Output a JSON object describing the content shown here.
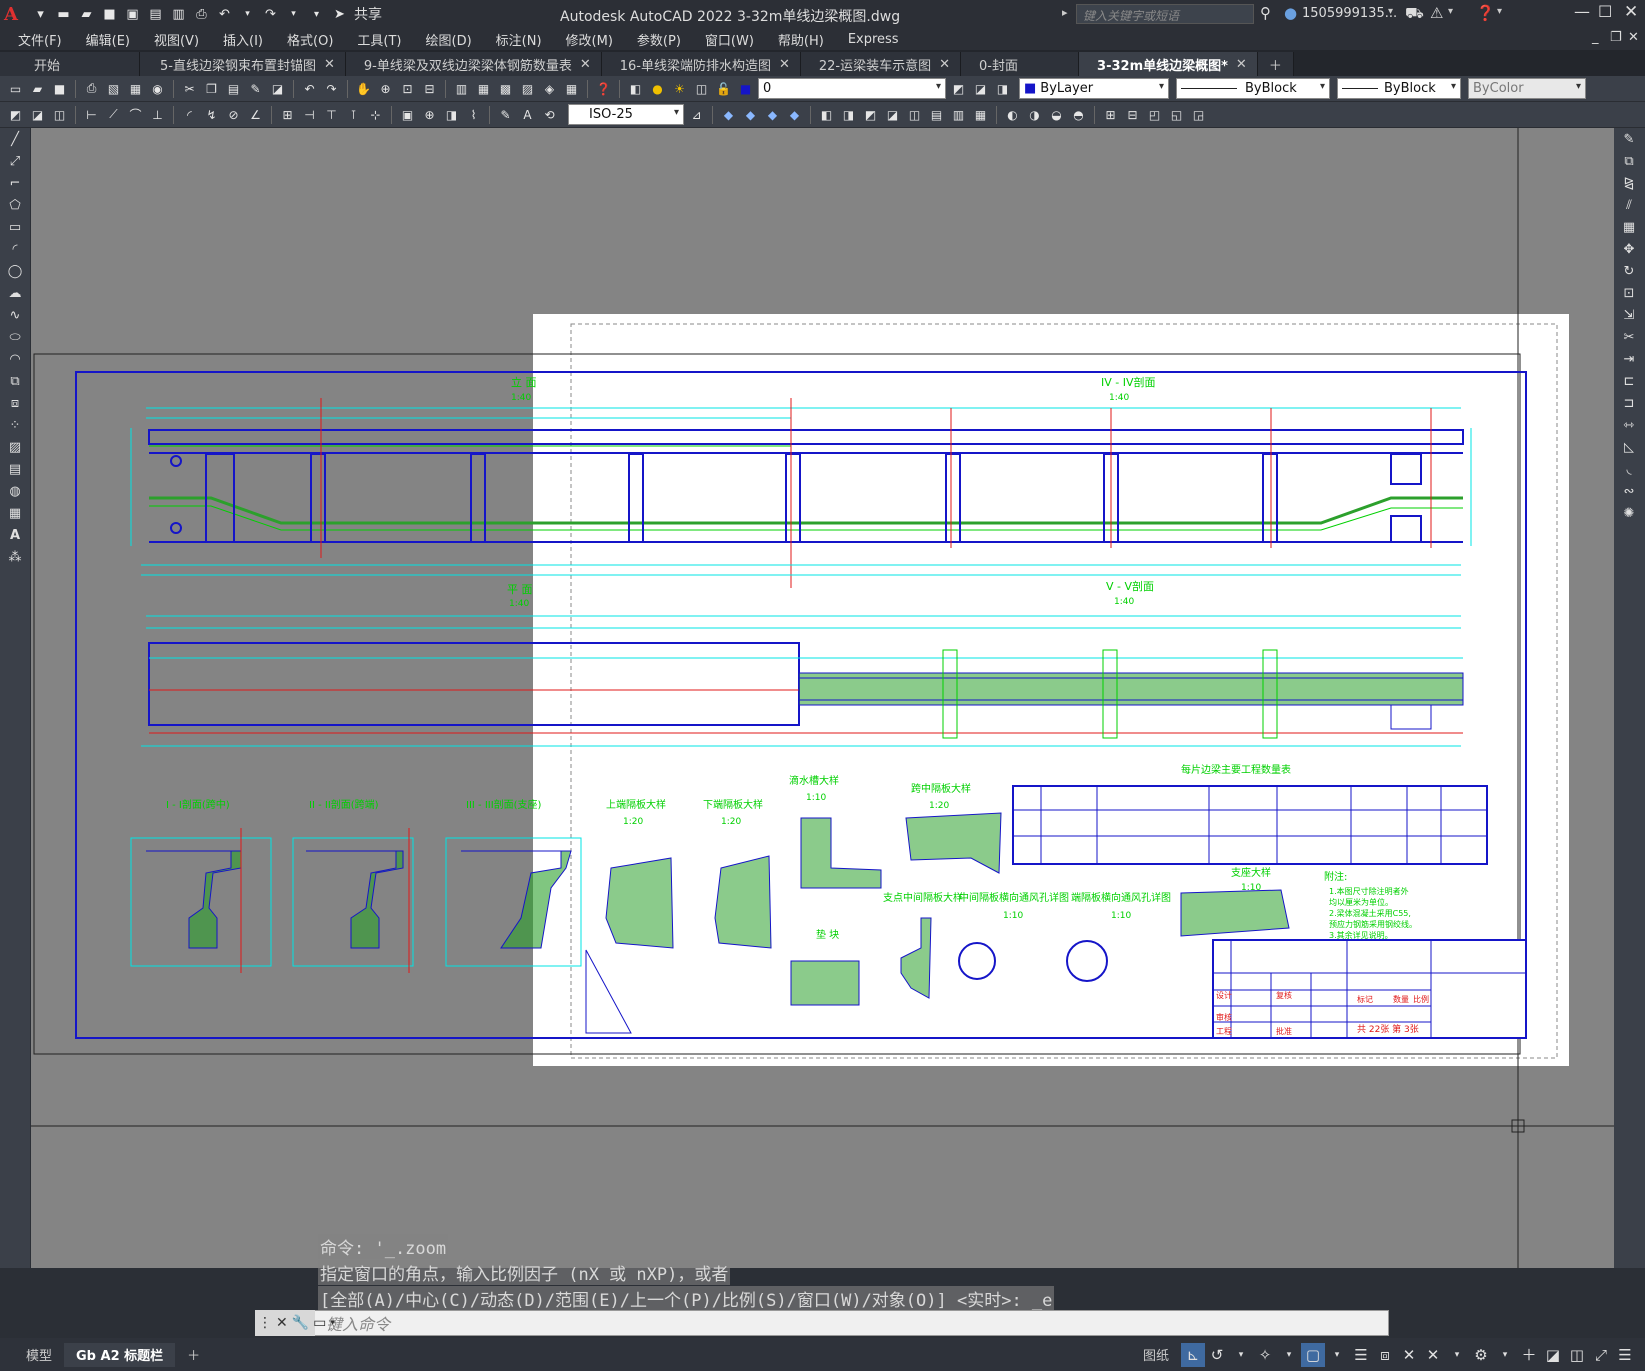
{
  "titlebar": {
    "app_title": "Autodesk AutoCAD 2022    3-32m单线边梁概图.dwg",
    "share_label": "共享",
    "search_placeholder": "键入关键字或短语",
    "user_name": "1505999135..."
  },
  "menu": [
    "文件(F)",
    "编辑(E)",
    "视图(V)",
    "插入(I)",
    "格式(O)",
    "工具(T)",
    "绘图(D)",
    "标注(N)",
    "修改(M)",
    "参数(P)",
    "窗口(W)",
    "帮助(H)",
    "Express"
  ],
  "tabs": [
    {
      "label": "开始",
      "closable": false,
      "active": false
    },
    {
      "label": "5-直线边梁钢束布置封锚图",
      "closable": true,
      "active": false
    },
    {
      "label": "9-单线梁及双线边梁梁体钢筋数量表",
      "closable": true,
      "active": false
    },
    {
      "label": "16-单线梁端防排水构造图",
      "closable": true,
      "active": false
    },
    {
      "label": "22-运梁装车示意图",
      "closable": true,
      "active": false
    },
    {
      "label": "0-封面",
      "closable": false,
      "active": false
    },
    {
      "label": "3-32m单线边梁概图*",
      "closable": true,
      "active": true
    }
  ],
  "toolbar": {
    "layer_value": "0",
    "color_value": "ByLayer",
    "linetype_value": "ByBlock",
    "lineweight_value": "ByBlock",
    "plotstyle_value": "ByColor",
    "dimstyle_value": "ISO-25"
  },
  "drawing": {
    "elev_title": "立  面",
    "elev_scale": "1:40",
    "sec4_title": "IV - IV剖面",
    "sec4_scale": "1:40",
    "plan_title": "平  面",
    "plan_scale": "1:40",
    "sec5_title": "V - V剖面",
    "sec5_scale": "1:40",
    "sec11_title": "I - I剖面(跨中)",
    "sec22_title": "II - II剖面(跨端)",
    "sec33_title": "III - III剖面(支座)",
    "sec_scale_20": "1:20",
    "top_sep_title": "上端隔板大样",
    "bot_sep_title": "下端隔板大样",
    "drip_title": "滴水槽大样",
    "drip_scale": "1:10",
    "mid_sep_title": "跨中隔板大样",
    "mid_sep2_title": "支点中间隔板大样",
    "vent_title": "中间隔板横向通风孔详图",
    "endvent_title": "端隔板横向通风孔详图",
    "scale_10": "1:10",
    "block_title": "垫  块",
    "table_title": "每片边梁主要工程数量表",
    "notes_title": "附注:",
    "notes": [
      "1.本图尺寸除注明者外",
      "  均以厘米为单位。",
      "2.梁体混凝土采用C55,",
      "  预应力钢筋采用钢绞线。",
      "3.其余详见说明。"
    ],
    "bearing_title": "支座大样",
    "bearing_scale": "1:10",
    "sheet_info": "共 22张 第 3张",
    "tb_design": "设计",
    "tb_check": "复核",
    "tb_review": "审核",
    "tb_approve": "批准",
    "tb_chief": "工程",
    "tb_type": "标记",
    "tb_count": "数量",
    "tb_ratio": "比例"
  },
  "command": {
    "line1": "命令: '_.zoom",
    "line2": "指定窗口的角点，输入比例因子 (nX 或 nXP)，或者",
    "line3": "[全部(A)/中心(C)/动态(D)/范围(E)/上一个(P)/比例(S)/窗口(W)/对象(O)] <实时>: _e",
    "input_placeholder": "键入命令"
  },
  "status": {
    "model_tab": "模型",
    "layout_tab": "Gb A2 标题栏",
    "paper_label": "图纸"
  },
  "colors": {
    "cyan": "#00e5e5",
    "blue": "#1515c8",
    "green": "#00d000",
    "red": "#e01818",
    "yellow": "#e0c020",
    "hatch": "#2ca02c"
  }
}
